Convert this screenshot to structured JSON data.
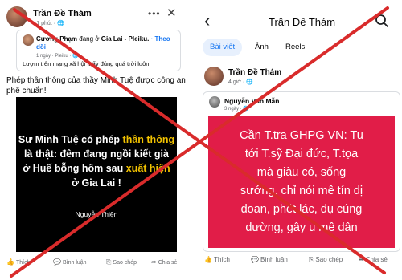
{
  "left_post": {
    "author": "Trần Đề Thám",
    "subline": "· 1 phút · 🌐",
    "shared": {
      "author": "Cương Phạm",
      "verb": " đang ở ",
      "place": "Gia Lai - Pleiku.",
      "follow": "· Theo dõi",
      "meta": "1 ngày · Pleiku · 🌐",
      "text": "Lượm trên mạng xã hội thấy đúng quá trời luôn!"
    },
    "caption": "Phép thần thông của thầy Minh Tuệ được công an phê chuẩn!",
    "image": {
      "line1_a": "Sư Minh Tuệ có phép ",
      "line1_b": "thần thông",
      "line2": "là thật: đêm đang ngồi kiết già",
      "line3_a": "ở Huế bỗng hôm sau ",
      "line3_b": "xuất hiện",
      "line4": "ở Gia Lai !",
      "signature": "Nguyễn Thiện"
    },
    "actions": {
      "like": "Thích",
      "comment": "Bình luận",
      "copy": "Sao chép",
      "share": "Chia sẻ"
    }
  },
  "right_post": {
    "page_title": "Trần Đề Thám",
    "tabs": [
      "Bài viết",
      "Ảnh",
      "Reels"
    ],
    "author": "Trần Đề Thám",
    "time": "4 giờ · 🌐",
    "inner_author": "Nguyễn Văn Mẫn",
    "inner_time": "3 ngày · 🌐",
    "text_lines": [
      "Cần T.tra GHPG VN: Tu",
      "tới T.sỹ Đại đức, T.tọa",
      "mà giàu có, sống",
      "sướng, chỉ nói mê tín dị",
      "đoan, phét lác, dụ cúng",
      "dường, gây u mê dân"
    ],
    "actions": {
      "like": "Thích",
      "comment": "Bình luận",
      "copy": "Sao chép",
      "share": "Chia sẻ"
    }
  },
  "colors": {
    "cross": "#d92b2b",
    "red_box": "#e11d48",
    "highlight": "#f2c200",
    "facebook_blue": "#1877f2"
  }
}
